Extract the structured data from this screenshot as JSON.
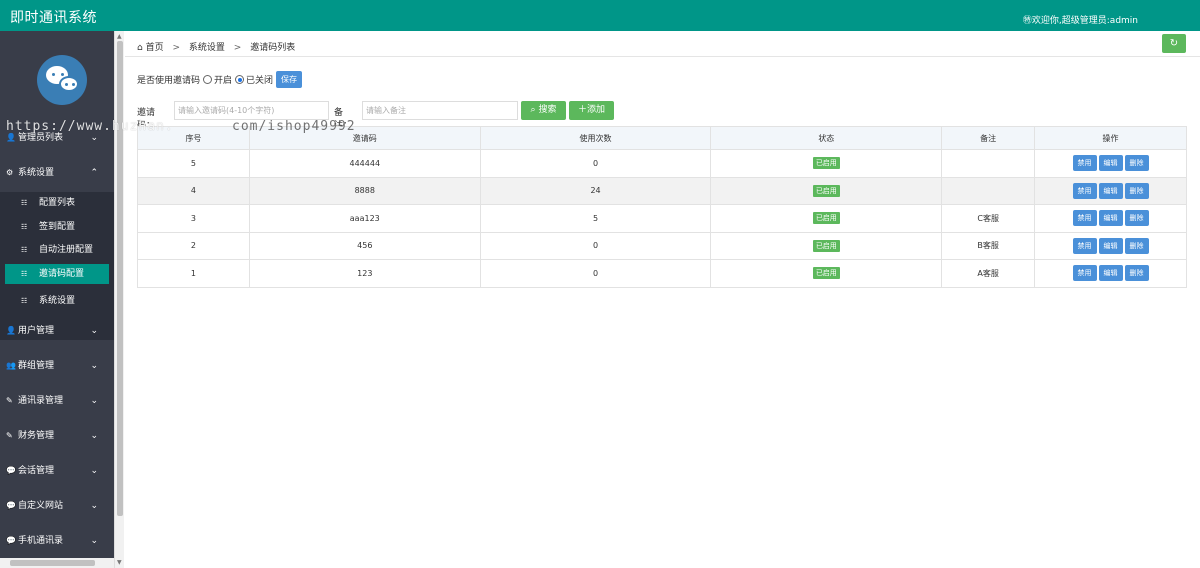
{
  "header": {
    "app_title": "即时通讯系统",
    "welcome": "㊕欢迎你,超级管理员:admin"
  },
  "sidebar": {
    "menus": [
      {
        "label": "管理员列表",
        "icon": "user-icon",
        "chevron": "down"
      },
      {
        "label": "系统设置",
        "icon": "gear-icon",
        "chevron": "up"
      },
      {
        "label": "用户管理",
        "icon": "user-icon",
        "chevron": "down"
      },
      {
        "label": "群组管理",
        "icon": "users-icon",
        "chevron": "down"
      },
      {
        "label": "通讯录管理",
        "icon": "edit-icon",
        "chevron": "down"
      },
      {
        "label": "财务管理",
        "icon": "edit-icon",
        "chevron": "down"
      },
      {
        "label": "会话管理",
        "icon": "chat-icon",
        "chevron": "down"
      },
      {
        "label": "自定义网站",
        "icon": "chat-icon",
        "chevron": "down"
      },
      {
        "label": "手机通讯录",
        "icon": "chat-icon",
        "chevron": "down"
      }
    ],
    "sub_items": [
      {
        "label": "配置列表"
      },
      {
        "label": "签到配置"
      },
      {
        "label": "自动注册配置"
      },
      {
        "label": "邀请码配置",
        "active": true
      },
      {
        "label": "系统设置"
      }
    ]
  },
  "breadcrumb": {
    "home": "首页",
    "level1": "系统设置",
    "level2": "邀请码列表",
    "sep": ">"
  },
  "invite_option": {
    "label": "是否使用邀请码",
    "on_label": "开启",
    "off_label": "已关闭",
    "selected": "已关闭",
    "save": "保存"
  },
  "search": {
    "code_label": "邀请码：",
    "code_placeholder": "请输入邀请码(4-10个字符)",
    "note_label": "备注：",
    "note_placeholder": "请输入备注",
    "search_btn": "搜索",
    "add_btn": "添加"
  },
  "table": {
    "headers": [
      "序号",
      "邀请码",
      "使用次数",
      "状态",
      "备注",
      "操作"
    ],
    "rows": [
      {
        "id": "5",
        "code": "444444",
        "uses": "0",
        "status": "已启用",
        "note": ""
      },
      {
        "id": "4",
        "code": "8888",
        "uses": "24",
        "status": "已启用",
        "note": ""
      },
      {
        "id": "3",
        "code": "aaa123",
        "uses": "5",
        "status": "已启用",
        "note": "C客服"
      },
      {
        "id": "2",
        "code": "456",
        "uses": "0",
        "status": "已启用",
        "note": "B客服"
      },
      {
        "id": "1",
        "code": "123",
        "uses": "0",
        "status": "已启用",
        "note": "A客服"
      }
    ],
    "actions": [
      "禁用",
      "编辑",
      "删除"
    ]
  },
  "watermark": {
    "a": "https://www.huzhan.",
    "b": "com/ishop49992"
  },
  "colors": {
    "topbar": "#009688",
    "sidebar": "#393d49",
    "active": "#009688",
    "green": "#5cb85c",
    "blue": "#4a90d9"
  }
}
